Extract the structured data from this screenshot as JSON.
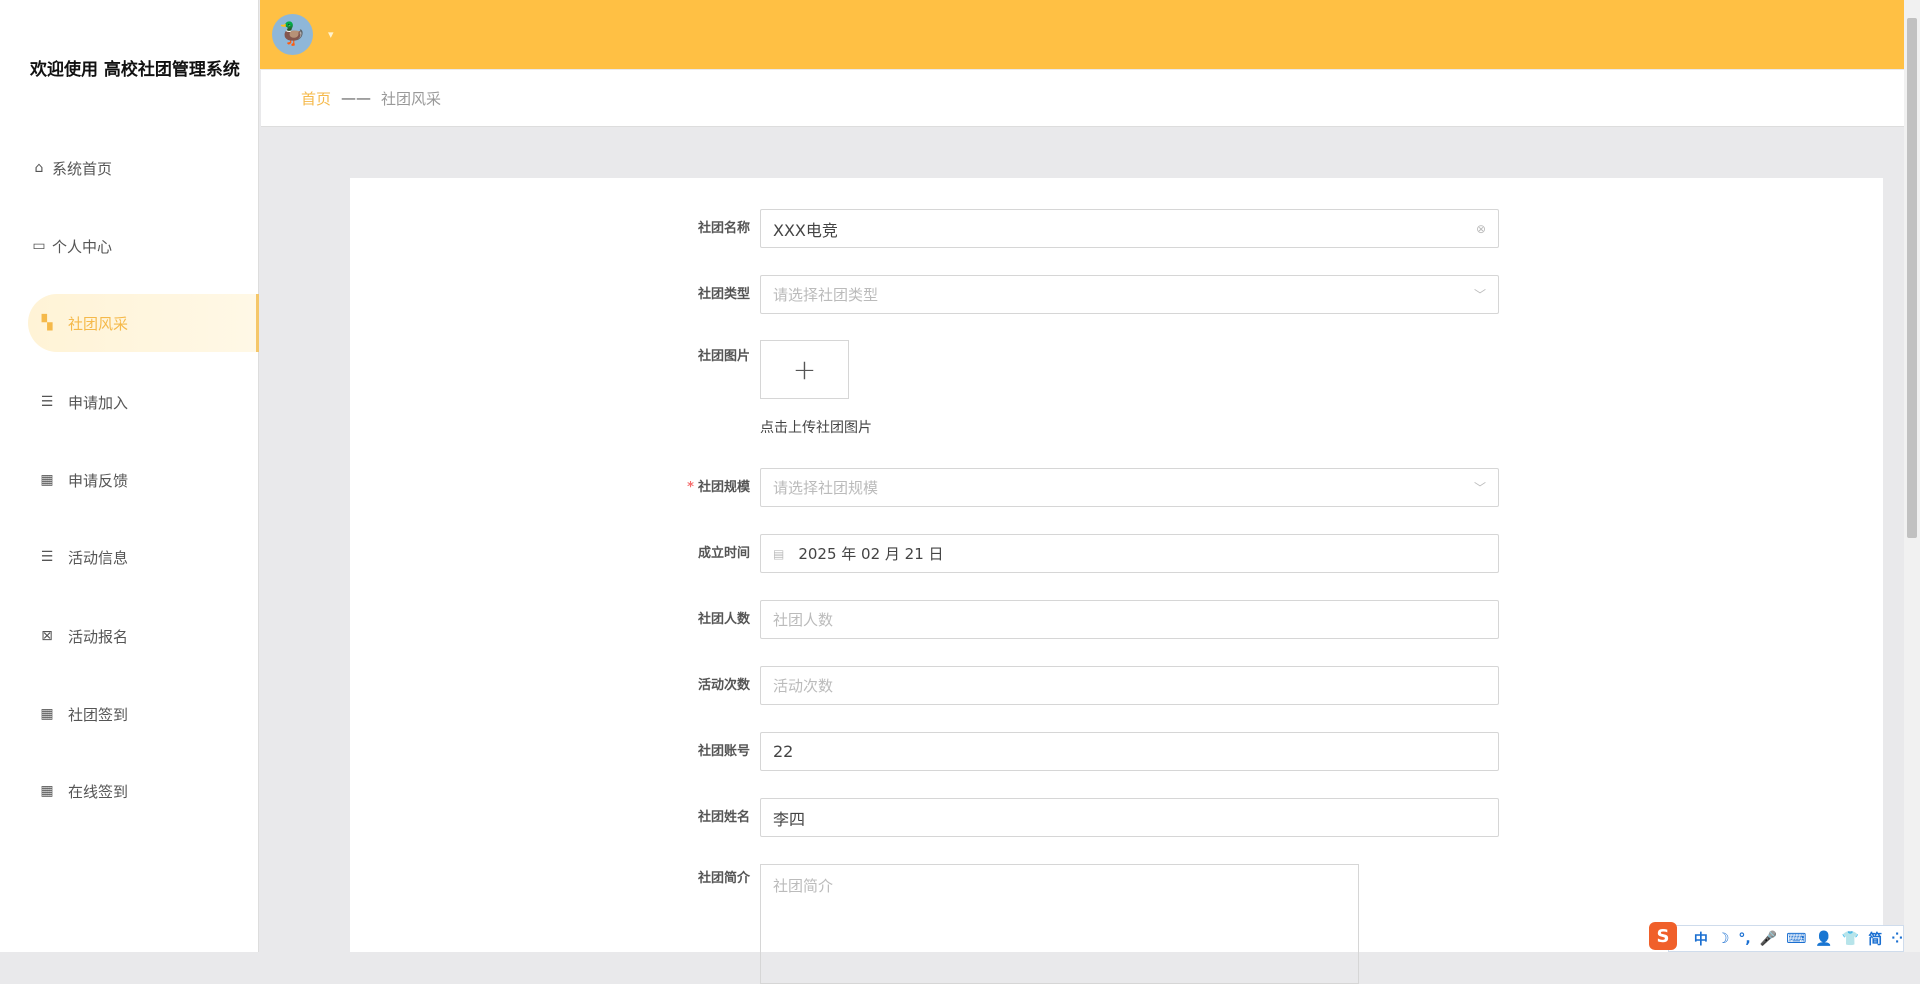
{
  "sidebar": {
    "title": "欢迎使用 高校社团管理系统",
    "items": [
      {
        "label": "系统首页",
        "icon": "home-icon"
      },
      {
        "label": "个人中心",
        "icon": "wallet-icon"
      },
      {
        "label": "社团风采",
        "icon": "ticket-icon",
        "active": true
      },
      {
        "label": "申请加入",
        "icon": "list-icon"
      },
      {
        "label": "申请反馈",
        "icon": "grid-icon"
      },
      {
        "label": "活动信息",
        "icon": "list-icon"
      },
      {
        "label": "活动报名",
        "icon": "clipboard-icon"
      },
      {
        "label": "社团签到",
        "icon": "grid-icon"
      },
      {
        "label": "在线签到",
        "icon": "grid-icon"
      }
    ]
  },
  "header": {
    "avatar_icon": "duck-avatar",
    "caret": "▾"
  },
  "breadcrumb": {
    "home": "首页",
    "sep": "——",
    "current": "社团风采"
  },
  "form": {
    "name": {
      "label": "社团名称",
      "value": "XXX电竞"
    },
    "type": {
      "label": "社团类型",
      "placeholder": "请选择社团类型"
    },
    "image": {
      "label": "社团图片",
      "hint": "点击上传社团图片"
    },
    "scale": {
      "label": "社团规模",
      "placeholder": "请选择社团规模",
      "required": "*"
    },
    "founded": {
      "label": "成立时间",
      "value": "2025 年 02 月 21 日"
    },
    "members": {
      "label": "社团人数",
      "placeholder": "社团人数"
    },
    "activities": {
      "label": "活动次数",
      "placeholder": "活动次数"
    },
    "account": {
      "label": "社团账号",
      "value": "22"
    },
    "owner": {
      "label": "社团姓名",
      "value": "李四"
    },
    "intro": {
      "label": "社团简介",
      "placeholder": "社团简介"
    }
  },
  "ime": {
    "items": [
      "中",
      "☽",
      "°,",
      "🎤",
      "⌨",
      "👤",
      "👕",
      "简",
      "⁘"
    ]
  }
}
